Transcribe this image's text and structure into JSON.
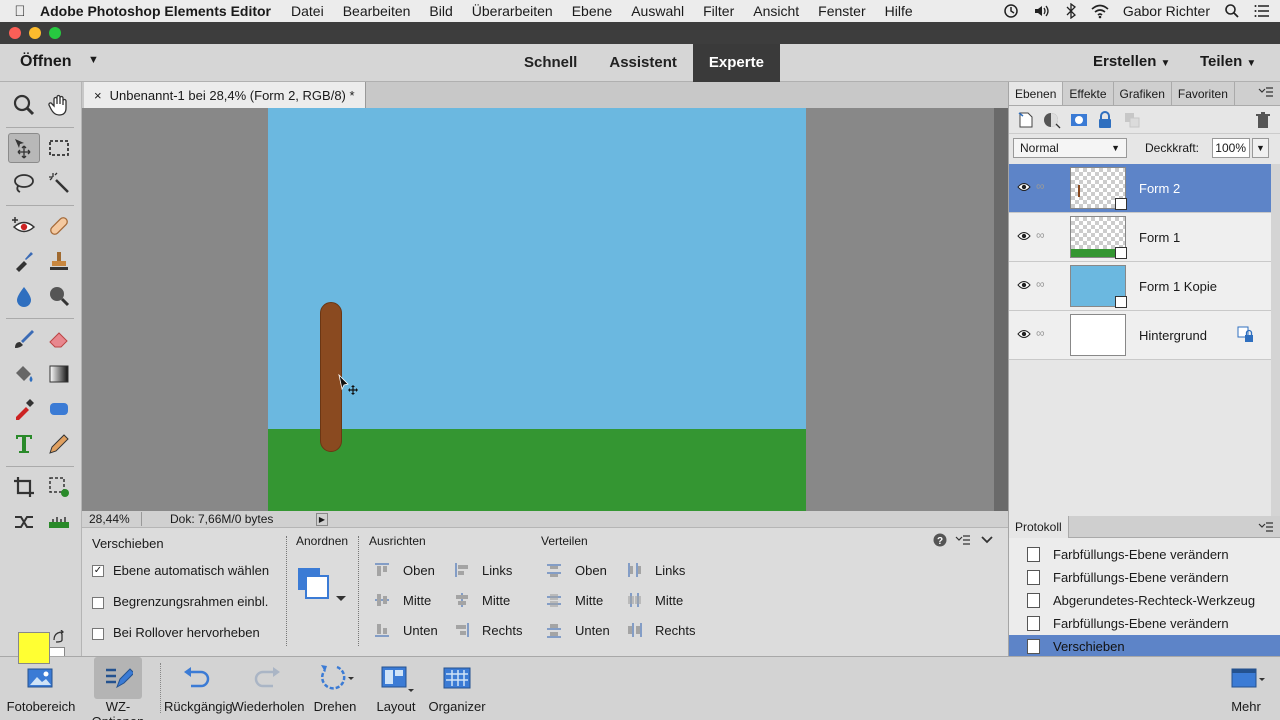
{
  "menubar": {
    "app_name": "Adobe Photoshop Elements Editor",
    "items": [
      "Datei",
      "Bearbeiten",
      "Bild",
      "Überarbeiten",
      "Ebene",
      "Auswahl",
      "Filter",
      "Ansicht",
      "Fenster",
      "Hilfe"
    ],
    "user": "Gabor Richter"
  },
  "header": {
    "open_label": "Öffnen",
    "modes": [
      "Schnell",
      "Assistent",
      "Experte"
    ],
    "active_mode": "Experte",
    "create_label": "Erstellen",
    "share_label": "Teilen"
  },
  "document": {
    "tab_title": "Unbenannt-1 bei 28,4% (Form 2, RGB/8) *",
    "close_glyph": "×",
    "canvas_colors": {
      "sky": "#6bb8e0",
      "ground": "#349632",
      "trunk": "#8a4a20"
    }
  },
  "status": {
    "zoom": "28,44%",
    "doc_size": "Dok: 7,66M/0 bytes"
  },
  "tool_options": {
    "tool_name": "Verschieben",
    "checkboxes": [
      {
        "label": "Ebene automatisch wählen",
        "checked": true
      },
      {
        "label": "Begrenzungsrahmen einbl.",
        "checked": false
      },
      {
        "label": "Bei Rollover hervorheben",
        "checked": false
      }
    ],
    "arrange": {
      "heading": "Anordnen"
    },
    "align": {
      "heading": "Ausrichten",
      "col1": [
        "Oben",
        "Mitte",
        "Unten"
      ],
      "col2": [
        "Links",
        "Mitte",
        "Rechts"
      ]
    },
    "distribute": {
      "heading": "Verteilen",
      "col1": [
        "Oben",
        "Mitte",
        "Unten"
      ],
      "col2": [
        "Links",
        "Mitte",
        "Rechts"
      ]
    }
  },
  "layers_panel": {
    "tabs": [
      "Ebenen",
      "Effekte",
      "Grafiken",
      "Favoriten"
    ],
    "active_tab": "Ebenen",
    "blend_mode": "Normal",
    "opacity_label": "Deckkraft:",
    "opacity_value": "100%",
    "layers": [
      {
        "name": "Form 2",
        "selected": true
      },
      {
        "name": "Form 1",
        "selected": false
      },
      {
        "name": "Form 1 Kopie",
        "selected": false
      },
      {
        "name": "Hintergrund",
        "selected": false
      }
    ]
  },
  "history_panel": {
    "title": "Protokoll",
    "items": [
      "Farbfüllungs-Ebene verändern",
      "Farbfüllungs-Ebene verändern",
      "Abgerundetes-Rechteck-Werkzeug",
      "Farbfüllungs-Ebene verändern",
      "Verschieben"
    ],
    "active_index": 4
  },
  "taskbar": {
    "buttons": [
      "Fotobereich",
      "WZ-Optionen",
      "Rückgängig",
      "Wiederholen",
      "Drehen",
      "Layout",
      "Organizer"
    ],
    "more_label": "Mehr"
  },
  "colors": {
    "foreground": "#ffff33",
    "background": "#ffffff",
    "selection": "#5d84c8"
  }
}
